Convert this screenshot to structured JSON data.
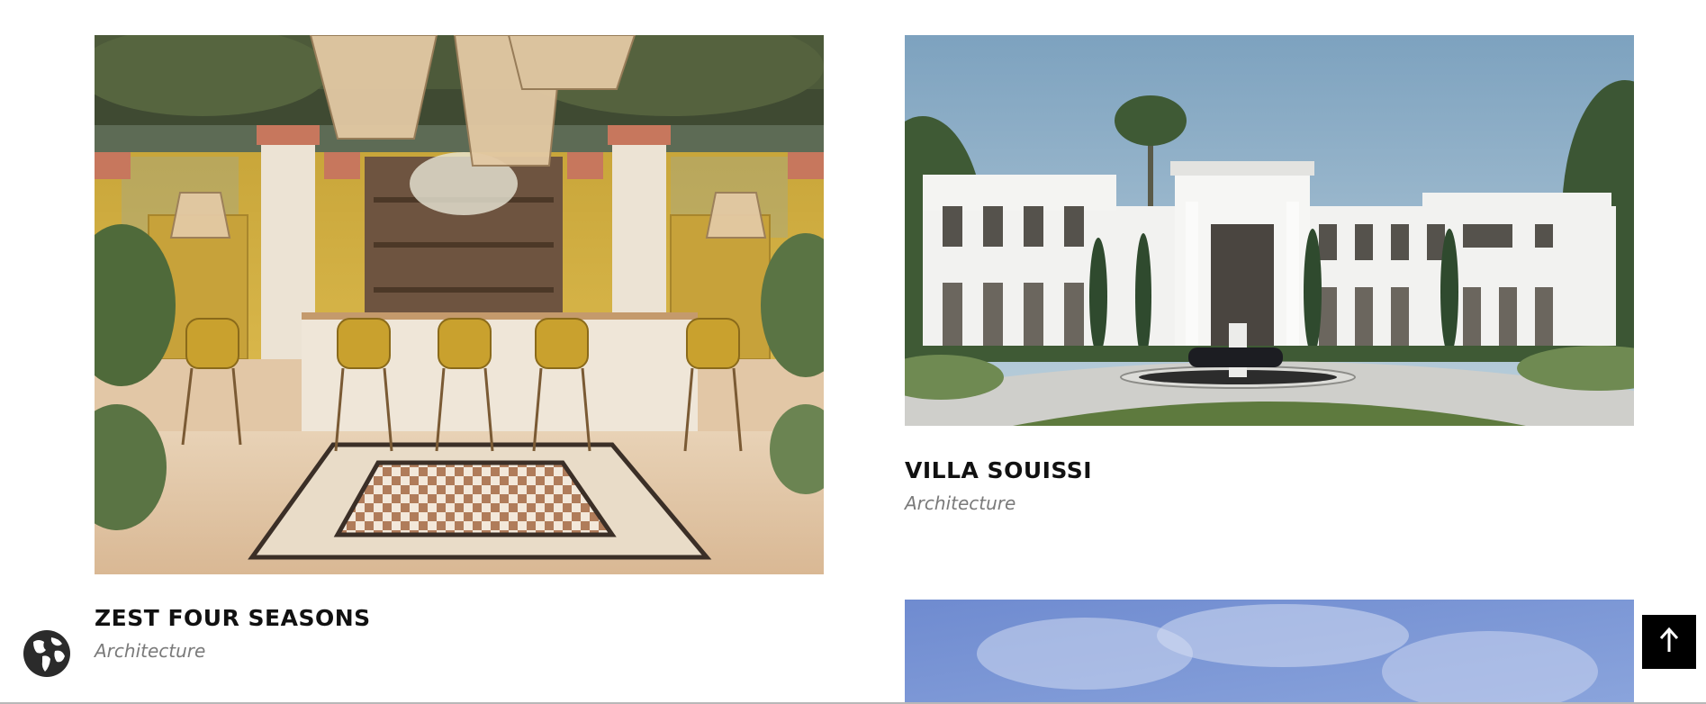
{
  "projects": [
    {
      "title": "ZEST FOUR SEASONS",
      "category": "Architecture",
      "image": "bar-terrace-render"
    },
    {
      "title": "VILLA SOUISSI",
      "category": "Architecture",
      "image": "white-villa-render"
    },
    {
      "image": "sky-render"
    }
  ],
  "icons": {
    "language": "globe-icon",
    "scroll_top": "arrow-up-icon"
  },
  "colors": {
    "title": "#111111",
    "category": "#7a7a7a",
    "scroll_top_bg": "#000000",
    "globe": "#2b2b2b"
  }
}
